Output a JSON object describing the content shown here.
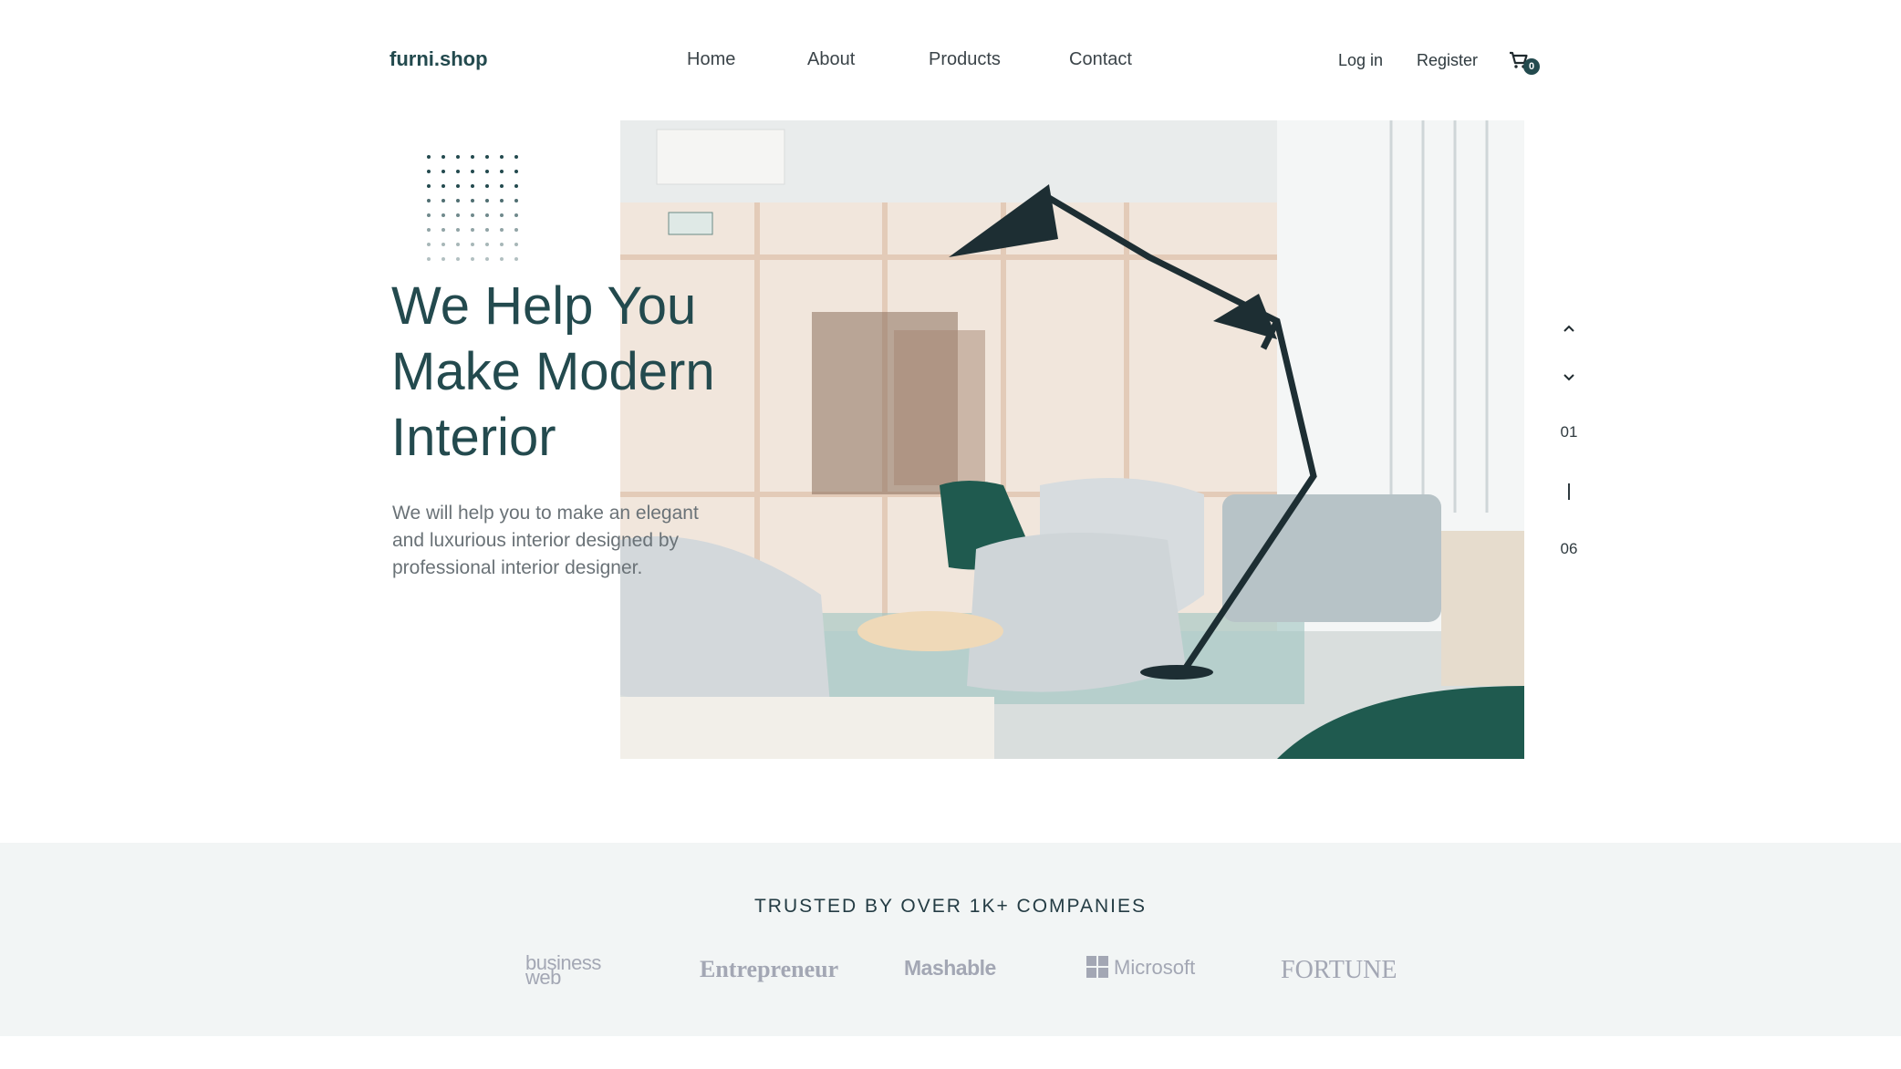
{
  "header": {
    "logo": "furni.shop",
    "nav": [
      {
        "label": "Home"
      },
      {
        "label": "About"
      },
      {
        "label": "Products"
      },
      {
        "label": "Contact"
      }
    ],
    "login_label": "Log in",
    "register_label": "Register",
    "cart_count": "0"
  },
  "hero": {
    "headline_lines": [
      "We Help You",
      "Make Modern",
      "Interior"
    ],
    "subtext": "We will help you to make an elegant and luxurious interior designed by professional interior designer.",
    "image_alt": "modern interior with chairs and floor lamp"
  },
  "slider": {
    "current": "01",
    "total": "06"
  },
  "trusted": {
    "title": "TRUSTED BY OVER 1K+ COMPANIES",
    "brands": [
      {
        "name_l1": "business",
        "name_l2": "web"
      },
      {
        "name": "Entrepreneur"
      },
      {
        "name": "Mashable"
      },
      {
        "name": "Microsoft"
      },
      {
        "name": "FORTUNE"
      }
    ]
  },
  "colors": {
    "primary": "#234a4e",
    "text": "#2f3a3f",
    "muted": "#6a7277",
    "strip_bg": "#f2f5f5",
    "brand_gray": "#a3a7b4"
  }
}
